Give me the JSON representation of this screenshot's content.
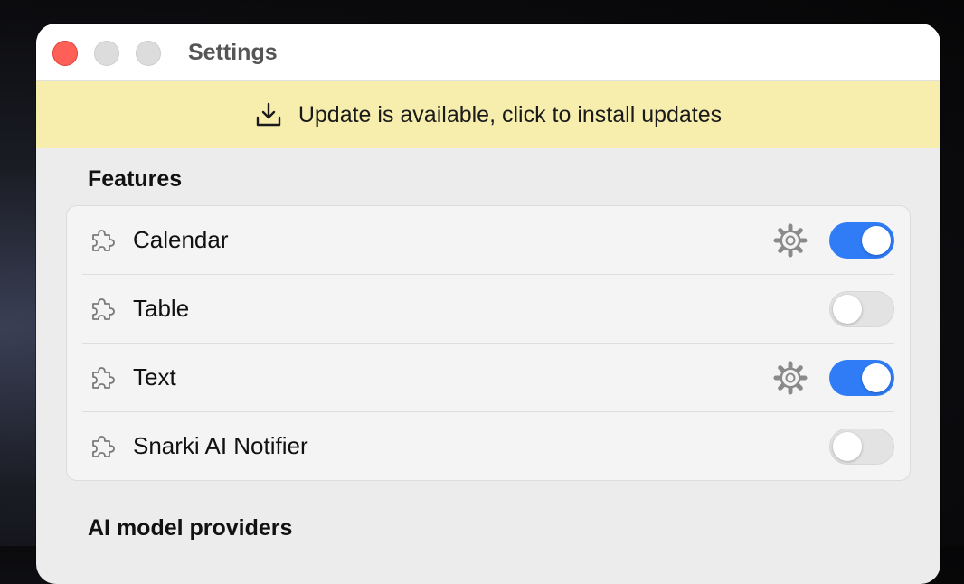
{
  "window": {
    "title": "Settings"
  },
  "banner": {
    "text": "Update is available, click to install updates",
    "icon": "download-icon"
  },
  "features": {
    "title": "Features",
    "items": [
      {
        "label": "Calendar",
        "icon": "puzzle-icon",
        "has_settings": true,
        "enabled": true
      },
      {
        "label": "Table",
        "icon": "puzzle-icon",
        "has_settings": false,
        "enabled": false
      },
      {
        "label": "Text",
        "icon": "puzzle-icon",
        "has_settings": true,
        "enabled": true
      },
      {
        "label": "Snarki AI Notifier",
        "icon": "puzzle-icon",
        "has_settings": false,
        "enabled": false
      }
    ]
  },
  "providers": {
    "title": "AI model providers"
  },
  "colors": {
    "accent": "#2f7cf6",
    "banner": "#f7eeae",
    "close": "#fe5f57"
  }
}
